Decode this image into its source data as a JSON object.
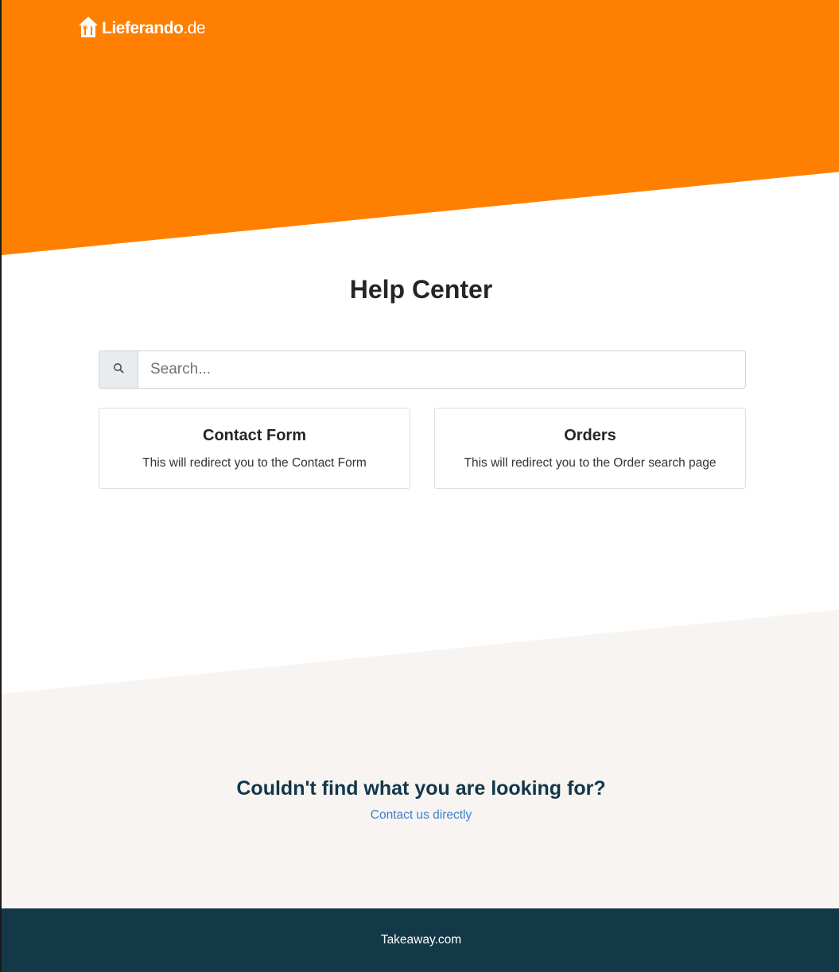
{
  "brand": {
    "logo_name": "Lieferando",
    "logo_tld": ".de",
    "logo_icon": "house-fork-knife-icon"
  },
  "main": {
    "title": "Help Center",
    "search": {
      "placeholder": "Search...",
      "value": "",
      "icon": "search-icon"
    },
    "cards": [
      {
        "title": "Contact Form",
        "description": "This will redirect you to the Contact Form"
      },
      {
        "title": "Orders",
        "description": "This will redirect you to the Order search page"
      }
    ]
  },
  "cta": {
    "title": "Couldn't find what you are looking for?",
    "link": "Contact us directly"
  },
  "footer": {
    "text": "Takeaway.com"
  },
  "colors": {
    "brand_orange": "#ff8000",
    "light_bg": "#f7f4f1",
    "footer_bg": "#133948",
    "link_blue": "#3f7fd3",
    "heading_dark": "#12374a"
  }
}
